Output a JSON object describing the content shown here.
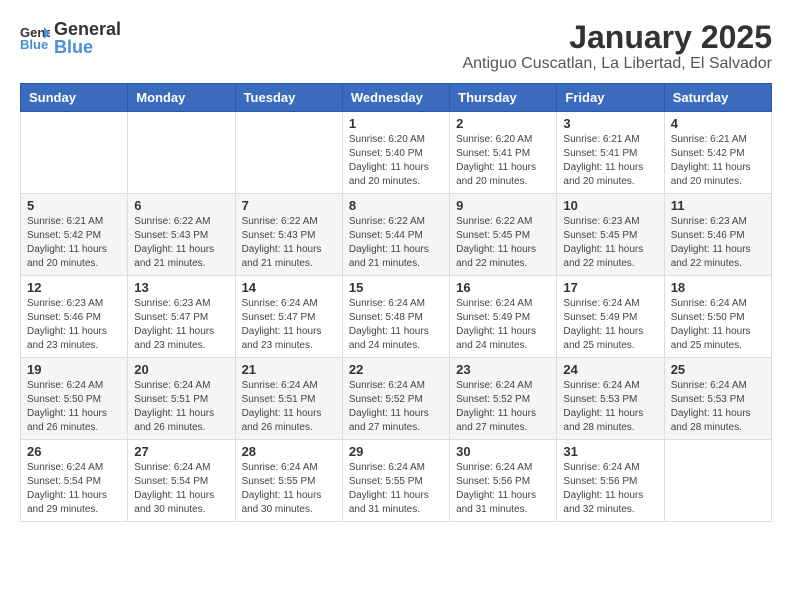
{
  "logo": {
    "general": "General",
    "blue": "Blue"
  },
  "title": "January 2025",
  "location": "Antiguo Cuscatlan, La Libertad, El Salvador",
  "weekdays": [
    "Sunday",
    "Monday",
    "Tuesday",
    "Wednesday",
    "Thursday",
    "Friday",
    "Saturday"
  ],
  "weeks": [
    [
      null,
      null,
      null,
      {
        "day": "1",
        "sunrise": "6:20 AM",
        "sunset": "5:40 PM",
        "daylight": "11 hours and 20 minutes."
      },
      {
        "day": "2",
        "sunrise": "6:20 AM",
        "sunset": "5:41 PM",
        "daylight": "11 hours and 20 minutes."
      },
      {
        "day": "3",
        "sunrise": "6:21 AM",
        "sunset": "5:41 PM",
        "daylight": "11 hours and 20 minutes."
      },
      {
        "day": "4",
        "sunrise": "6:21 AM",
        "sunset": "5:42 PM",
        "daylight": "11 hours and 20 minutes."
      }
    ],
    [
      {
        "day": "5",
        "sunrise": "6:21 AM",
        "sunset": "5:42 PM",
        "daylight": "11 hours and 20 minutes."
      },
      {
        "day": "6",
        "sunrise": "6:22 AM",
        "sunset": "5:43 PM",
        "daylight": "11 hours and 21 minutes."
      },
      {
        "day": "7",
        "sunrise": "6:22 AM",
        "sunset": "5:43 PM",
        "daylight": "11 hours and 21 minutes."
      },
      {
        "day": "8",
        "sunrise": "6:22 AM",
        "sunset": "5:44 PM",
        "daylight": "11 hours and 21 minutes."
      },
      {
        "day": "9",
        "sunrise": "6:22 AM",
        "sunset": "5:45 PM",
        "daylight": "11 hours and 22 minutes."
      },
      {
        "day": "10",
        "sunrise": "6:23 AM",
        "sunset": "5:45 PM",
        "daylight": "11 hours and 22 minutes."
      },
      {
        "day": "11",
        "sunrise": "6:23 AM",
        "sunset": "5:46 PM",
        "daylight": "11 hours and 22 minutes."
      }
    ],
    [
      {
        "day": "12",
        "sunrise": "6:23 AM",
        "sunset": "5:46 PM",
        "daylight": "11 hours and 23 minutes."
      },
      {
        "day": "13",
        "sunrise": "6:23 AM",
        "sunset": "5:47 PM",
        "daylight": "11 hours and 23 minutes."
      },
      {
        "day": "14",
        "sunrise": "6:24 AM",
        "sunset": "5:47 PM",
        "daylight": "11 hours and 23 minutes."
      },
      {
        "day": "15",
        "sunrise": "6:24 AM",
        "sunset": "5:48 PM",
        "daylight": "11 hours and 24 minutes."
      },
      {
        "day": "16",
        "sunrise": "6:24 AM",
        "sunset": "5:49 PM",
        "daylight": "11 hours and 24 minutes."
      },
      {
        "day": "17",
        "sunrise": "6:24 AM",
        "sunset": "5:49 PM",
        "daylight": "11 hours and 25 minutes."
      },
      {
        "day": "18",
        "sunrise": "6:24 AM",
        "sunset": "5:50 PM",
        "daylight": "11 hours and 25 minutes."
      }
    ],
    [
      {
        "day": "19",
        "sunrise": "6:24 AM",
        "sunset": "5:50 PM",
        "daylight": "11 hours and 26 minutes."
      },
      {
        "day": "20",
        "sunrise": "6:24 AM",
        "sunset": "5:51 PM",
        "daylight": "11 hours and 26 minutes."
      },
      {
        "day": "21",
        "sunrise": "6:24 AM",
        "sunset": "5:51 PM",
        "daylight": "11 hours and 26 minutes."
      },
      {
        "day": "22",
        "sunrise": "6:24 AM",
        "sunset": "5:52 PM",
        "daylight": "11 hours and 27 minutes."
      },
      {
        "day": "23",
        "sunrise": "6:24 AM",
        "sunset": "5:52 PM",
        "daylight": "11 hours and 27 minutes."
      },
      {
        "day": "24",
        "sunrise": "6:24 AM",
        "sunset": "5:53 PM",
        "daylight": "11 hours and 28 minutes."
      },
      {
        "day": "25",
        "sunrise": "6:24 AM",
        "sunset": "5:53 PM",
        "daylight": "11 hours and 28 minutes."
      }
    ],
    [
      {
        "day": "26",
        "sunrise": "6:24 AM",
        "sunset": "5:54 PM",
        "daylight": "11 hours and 29 minutes."
      },
      {
        "day": "27",
        "sunrise": "6:24 AM",
        "sunset": "5:54 PM",
        "daylight": "11 hours and 30 minutes."
      },
      {
        "day": "28",
        "sunrise": "6:24 AM",
        "sunset": "5:55 PM",
        "daylight": "11 hours and 30 minutes."
      },
      {
        "day": "29",
        "sunrise": "6:24 AM",
        "sunset": "5:55 PM",
        "daylight": "11 hours and 31 minutes."
      },
      {
        "day": "30",
        "sunrise": "6:24 AM",
        "sunset": "5:56 PM",
        "daylight": "11 hours and 31 minutes."
      },
      {
        "day": "31",
        "sunrise": "6:24 AM",
        "sunset": "5:56 PM",
        "daylight": "11 hours and 32 minutes."
      },
      null
    ]
  ]
}
